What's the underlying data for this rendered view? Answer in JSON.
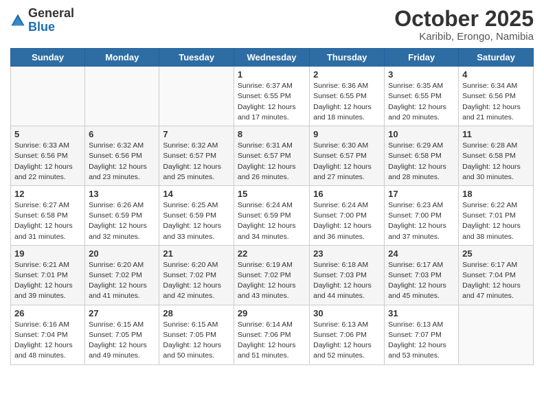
{
  "logo": {
    "general": "General",
    "blue": "Blue"
  },
  "header": {
    "title": "October 2025",
    "subtitle": "Karibib, Erongo, Namibia"
  },
  "weekdays": [
    "Sunday",
    "Monday",
    "Tuesday",
    "Wednesday",
    "Thursday",
    "Friday",
    "Saturday"
  ],
  "weeks": [
    [
      {
        "day": "",
        "info": ""
      },
      {
        "day": "",
        "info": ""
      },
      {
        "day": "",
        "info": ""
      },
      {
        "day": "1",
        "info": "Sunrise: 6:37 AM\nSunset: 6:55 PM\nDaylight: 12 hours\nand 17 minutes."
      },
      {
        "day": "2",
        "info": "Sunrise: 6:36 AM\nSunset: 6:55 PM\nDaylight: 12 hours\nand 18 minutes."
      },
      {
        "day": "3",
        "info": "Sunrise: 6:35 AM\nSunset: 6:55 PM\nDaylight: 12 hours\nand 20 minutes."
      },
      {
        "day": "4",
        "info": "Sunrise: 6:34 AM\nSunset: 6:56 PM\nDaylight: 12 hours\nand 21 minutes."
      }
    ],
    [
      {
        "day": "5",
        "info": "Sunrise: 6:33 AM\nSunset: 6:56 PM\nDaylight: 12 hours\nand 22 minutes."
      },
      {
        "day": "6",
        "info": "Sunrise: 6:32 AM\nSunset: 6:56 PM\nDaylight: 12 hours\nand 23 minutes."
      },
      {
        "day": "7",
        "info": "Sunrise: 6:32 AM\nSunset: 6:57 PM\nDaylight: 12 hours\nand 25 minutes."
      },
      {
        "day": "8",
        "info": "Sunrise: 6:31 AM\nSunset: 6:57 PM\nDaylight: 12 hours\nand 26 minutes."
      },
      {
        "day": "9",
        "info": "Sunrise: 6:30 AM\nSunset: 6:57 PM\nDaylight: 12 hours\nand 27 minutes."
      },
      {
        "day": "10",
        "info": "Sunrise: 6:29 AM\nSunset: 6:58 PM\nDaylight: 12 hours\nand 28 minutes."
      },
      {
        "day": "11",
        "info": "Sunrise: 6:28 AM\nSunset: 6:58 PM\nDaylight: 12 hours\nand 30 minutes."
      }
    ],
    [
      {
        "day": "12",
        "info": "Sunrise: 6:27 AM\nSunset: 6:58 PM\nDaylight: 12 hours\nand 31 minutes."
      },
      {
        "day": "13",
        "info": "Sunrise: 6:26 AM\nSunset: 6:59 PM\nDaylight: 12 hours\nand 32 minutes."
      },
      {
        "day": "14",
        "info": "Sunrise: 6:25 AM\nSunset: 6:59 PM\nDaylight: 12 hours\nand 33 minutes."
      },
      {
        "day": "15",
        "info": "Sunrise: 6:24 AM\nSunset: 6:59 PM\nDaylight: 12 hours\nand 34 minutes."
      },
      {
        "day": "16",
        "info": "Sunrise: 6:24 AM\nSunset: 7:00 PM\nDaylight: 12 hours\nand 36 minutes."
      },
      {
        "day": "17",
        "info": "Sunrise: 6:23 AM\nSunset: 7:00 PM\nDaylight: 12 hours\nand 37 minutes."
      },
      {
        "day": "18",
        "info": "Sunrise: 6:22 AM\nSunset: 7:01 PM\nDaylight: 12 hours\nand 38 minutes."
      }
    ],
    [
      {
        "day": "19",
        "info": "Sunrise: 6:21 AM\nSunset: 7:01 PM\nDaylight: 12 hours\nand 39 minutes."
      },
      {
        "day": "20",
        "info": "Sunrise: 6:20 AM\nSunset: 7:02 PM\nDaylight: 12 hours\nand 41 minutes."
      },
      {
        "day": "21",
        "info": "Sunrise: 6:20 AM\nSunset: 7:02 PM\nDaylight: 12 hours\nand 42 minutes."
      },
      {
        "day": "22",
        "info": "Sunrise: 6:19 AM\nSunset: 7:02 PM\nDaylight: 12 hours\nand 43 minutes."
      },
      {
        "day": "23",
        "info": "Sunrise: 6:18 AM\nSunset: 7:03 PM\nDaylight: 12 hours\nand 44 minutes."
      },
      {
        "day": "24",
        "info": "Sunrise: 6:17 AM\nSunset: 7:03 PM\nDaylight: 12 hours\nand 45 minutes."
      },
      {
        "day": "25",
        "info": "Sunrise: 6:17 AM\nSunset: 7:04 PM\nDaylight: 12 hours\nand 47 minutes."
      }
    ],
    [
      {
        "day": "26",
        "info": "Sunrise: 6:16 AM\nSunset: 7:04 PM\nDaylight: 12 hours\nand 48 minutes."
      },
      {
        "day": "27",
        "info": "Sunrise: 6:15 AM\nSunset: 7:05 PM\nDaylight: 12 hours\nand 49 minutes."
      },
      {
        "day": "28",
        "info": "Sunrise: 6:15 AM\nSunset: 7:05 PM\nDaylight: 12 hours\nand 50 minutes."
      },
      {
        "day": "29",
        "info": "Sunrise: 6:14 AM\nSunset: 7:06 PM\nDaylight: 12 hours\nand 51 minutes."
      },
      {
        "day": "30",
        "info": "Sunrise: 6:13 AM\nSunset: 7:06 PM\nDaylight: 12 hours\nand 52 minutes."
      },
      {
        "day": "31",
        "info": "Sunrise: 6:13 AM\nSunset: 7:07 PM\nDaylight: 12 hours\nand 53 minutes."
      },
      {
        "day": "",
        "info": ""
      }
    ]
  ]
}
